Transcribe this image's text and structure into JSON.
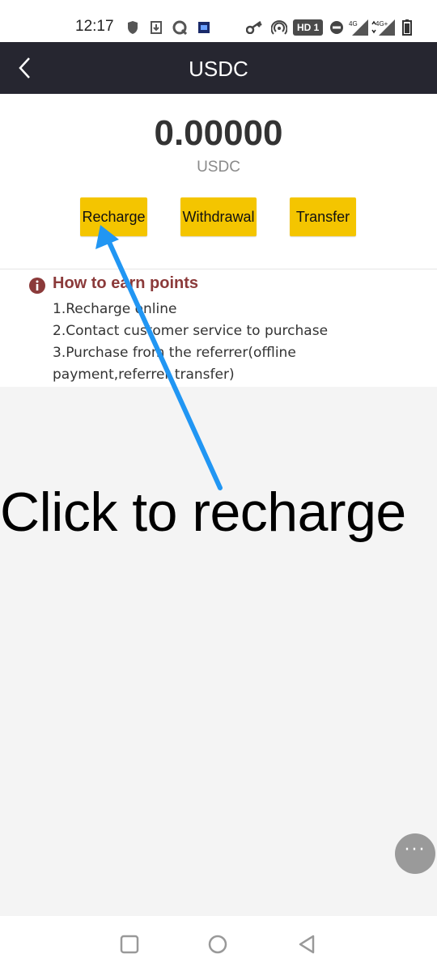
{
  "status_bar": {
    "time": "12:17",
    "hd_badge": "HD 1",
    "network_1": "4G",
    "network_2": "4G+"
  },
  "header": {
    "title": "USDC",
    "back_icon": "chevron-left-icon"
  },
  "balance": {
    "amount": "0.00000",
    "unit": "USDC"
  },
  "actions": {
    "recharge_label": "Recharge",
    "withdrawal_label": "Withdrawal",
    "transfer_label": "Transfer",
    "button_color": "#f4c500"
  },
  "info": {
    "title": "How to earn points",
    "title_color": "#8b3a3a",
    "items": [
      "1.Recharge online",
      "2.Contact customer service to purchase",
      "3.Purchase from the referrer(offline payment,referrer transfer)"
    ]
  },
  "annotation": {
    "text": "Click to recharge",
    "arrow_color": "#2196f3"
  },
  "fab": {
    "label": "···"
  }
}
